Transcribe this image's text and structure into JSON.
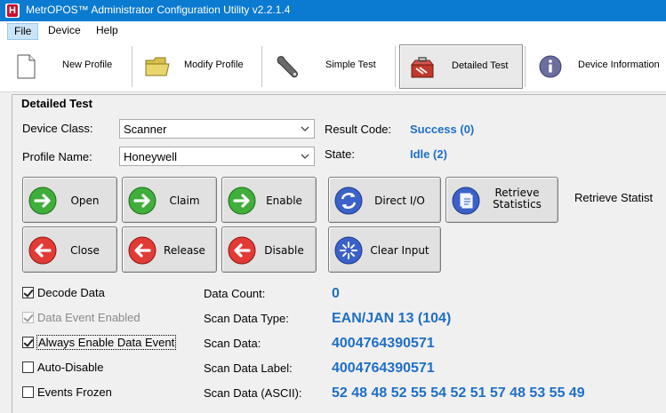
{
  "window": {
    "title": "MetrOPOS™ Administrator Configuration Utility v2.2.1.4"
  },
  "menu": {
    "items": [
      "File",
      "Device",
      "Help"
    ]
  },
  "toolbar": {
    "buttons": [
      "New Profile",
      "Modify Profile",
      "Simple Test",
      "Detailed Test",
      "Device Information"
    ],
    "active": "Detailed Test"
  },
  "panel": {
    "title": "Detailed Test",
    "device_class_label": "Device Class:",
    "device_class_value": "Scanner",
    "profile_name_label": "Profile Name:",
    "profile_name_value": "Honeywell",
    "result_code_label": "Result Code:",
    "result_code_value": "Success (0)",
    "state_label": "State:",
    "state_value": "Idle (2)",
    "retrieve_statistics_text": "Retrieve Statist"
  },
  "actions": {
    "open": "Open",
    "claim": "Claim",
    "enable": "Enable",
    "direct_io": "Direct I/O",
    "retrieve_line1": "Retrieve",
    "retrieve_line2": "Statistics",
    "close": "Close",
    "release": "Release",
    "disable": "Disable",
    "clear_input": "Clear Input"
  },
  "checkboxes": {
    "decode_data": {
      "label": "Decode Data",
      "checked": true
    },
    "data_event_enabled": {
      "label": "Data Event Enabled",
      "checked": true,
      "disabled": true
    },
    "always_enable": {
      "label": "Always Enable Data Event",
      "checked": true
    },
    "auto_disable": {
      "label": "Auto-Disable",
      "checked": false
    },
    "events_frozen": {
      "label": "Events Frozen",
      "checked": false
    }
  },
  "data_fields": {
    "data_count_label": "Data Count:",
    "data_count_value": "0",
    "scan_data_type_label": "Scan Data Type:",
    "scan_data_type_value": "EAN/JAN 13 (104)",
    "scan_data_label": "Scan Data:",
    "scan_data_value": "4004764390571",
    "scan_data_label_label": "Scan Data Label:",
    "scan_data_label_value": "4004764390571",
    "scan_data_ascii_label": "Scan Data (ASCII):",
    "scan_data_ascii_value": "52 48 48 52 55 54 52 51 57 48 53 55 49"
  },
  "colors": {
    "titlebar": "#0b7ad1",
    "value_blue": "#1f6fc5",
    "green_icon": "#3fae3a",
    "red_icon": "#e23b36",
    "blue_icon": "#3b62c8"
  },
  "icons": {
    "new_profile": "blank-page-icon",
    "modify_profile": "folder-icon",
    "simple_test": "wrench-icon",
    "detailed_test": "toolbox-icon",
    "device_information": "info-icon"
  }
}
